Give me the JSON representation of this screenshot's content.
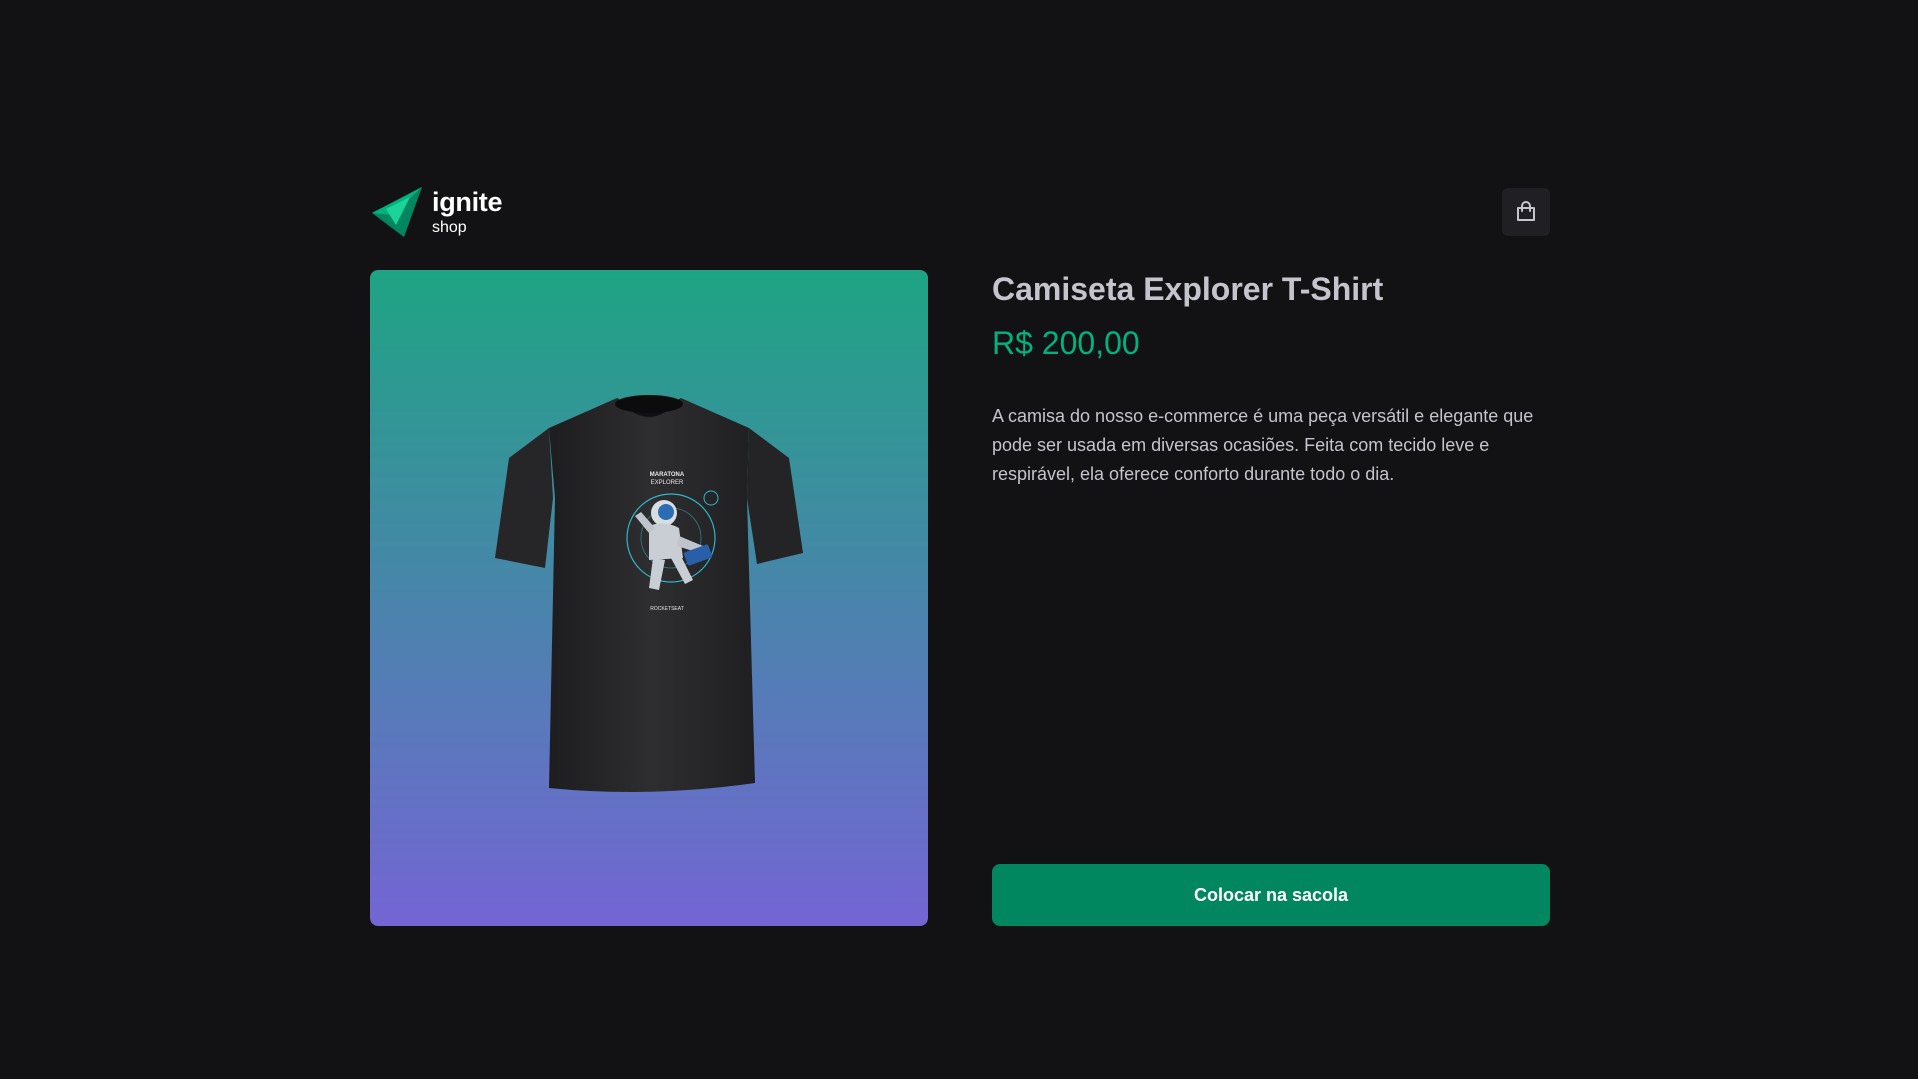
{
  "header": {
    "logo_word": "ignite",
    "logo_sub": "shop",
    "cart_icon": "shopping-bag-icon"
  },
  "product": {
    "title": "Camiseta Explorer T-Shirt",
    "price": "R$ 200,00",
    "description": "A camisa do nosso e-commerce é uma peça versátil e elegante que pode ser usada em diversas ocasiões. Feita com tecido leve e respirável, ela oferece conforto durante todo o dia.",
    "image_icon": "t-shirt-astronaut-image",
    "buy_label": "Colocar na sacola"
  },
  "colors": {
    "background": "#121214",
    "brand_green": "#00875f",
    "price_green": "#00b37e",
    "gradient_top": "#1ea483",
    "gradient_bottom": "#7465d4",
    "cart_bg": "#202024"
  }
}
